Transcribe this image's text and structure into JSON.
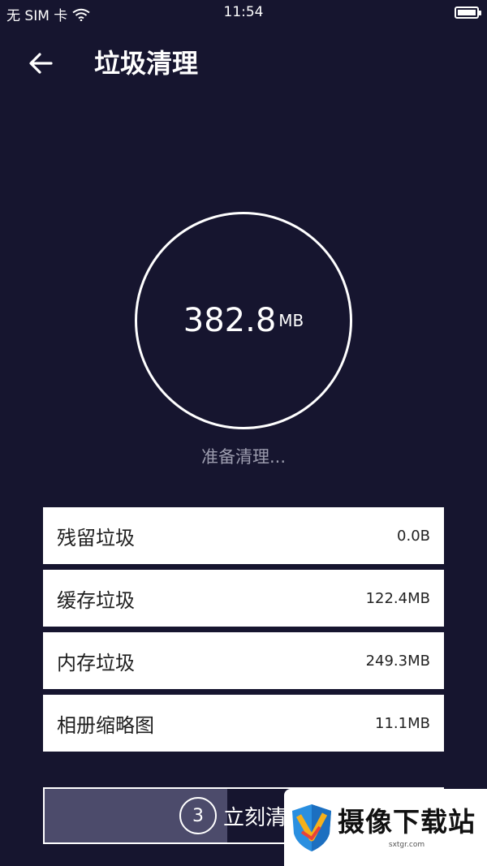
{
  "status_bar": {
    "carrier": "无 SIM 卡",
    "time": "11:54",
    "icons": [
      "wifi-icon",
      "battery-icon"
    ]
  },
  "header": {
    "title": "垃圾清理",
    "back_icon": "arrow-left-icon"
  },
  "gauge": {
    "value": "382.8",
    "unit": "MB"
  },
  "status_text": "准备清理...",
  "items": [
    {
      "label": "残留垃圾",
      "value": "0.0B"
    },
    {
      "label": "缓存垃圾",
      "value": "122.4MB"
    },
    {
      "label": "内存垃圾",
      "value": "249.3MB"
    },
    {
      "label": "相册缩略图",
      "value": "11.1MB"
    }
  ],
  "clean_button": {
    "countdown": "3",
    "label": "立刻清理",
    "progress_fraction": 0.46
  },
  "watermark": {
    "name": "摄像下载站",
    "url": "sxtgr.com"
  },
  "colors": {
    "background": "#16152f",
    "progress": "#4c4b6b",
    "card": "#ffffff"
  }
}
